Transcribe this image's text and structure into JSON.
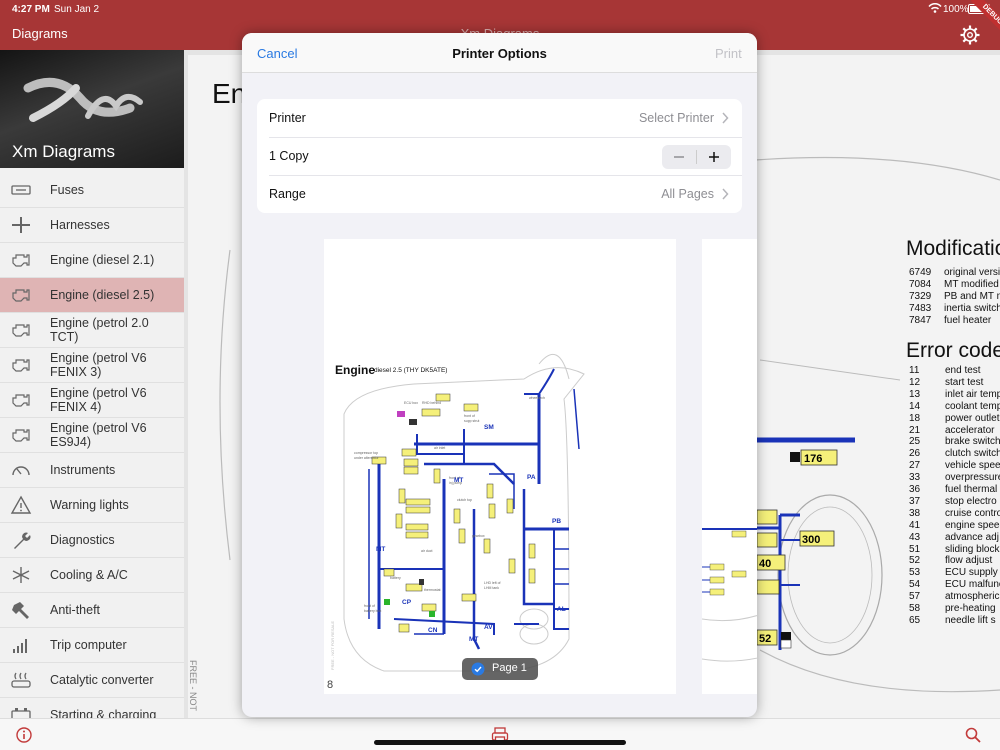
{
  "status": {
    "time": "4:27 PM",
    "date": "Sun Jan 2",
    "battery": "100%"
  },
  "nav": {
    "title": "Diagrams",
    "center_title": "Xm Diagrams",
    "debug_label": "DEBUG"
  },
  "sidebar": {
    "heading": "Xm Diagrams",
    "items": [
      {
        "label": "Fuses",
        "icon": "fuse-icon"
      },
      {
        "label": "Harnesses",
        "icon": "harness-icon"
      },
      {
        "label": "Engine (diesel 2.1)",
        "icon": "engine-icon"
      },
      {
        "label": "Engine (diesel 2.5)",
        "icon": "engine-icon",
        "selected": true
      },
      {
        "label": "Engine (petrol 2.0 TCT)",
        "icon": "engine-icon"
      },
      {
        "label": "Engine (petrol V6 FENIX 3)",
        "icon": "engine-icon"
      },
      {
        "label": "Engine (petrol V6 FENIX 4)",
        "icon": "engine-icon"
      },
      {
        "label": "Engine (petrol V6 ES9J4)",
        "icon": "engine-icon"
      },
      {
        "label": "Instruments",
        "icon": "gauge-icon"
      },
      {
        "label": "Warning lights",
        "icon": "warning-icon"
      },
      {
        "label": "Diagnostics",
        "icon": "wrench-icon"
      },
      {
        "label": "Cooling & A/C",
        "icon": "snowflake-icon"
      },
      {
        "label": "Anti-theft",
        "icon": "hammer-icon"
      },
      {
        "label": "Trip computer",
        "icon": "signal-icon"
      },
      {
        "label": "Catalytic converter",
        "icon": "catalytic-icon"
      },
      {
        "label": "Starting & charging",
        "icon": "battery-icon"
      }
    ]
  },
  "content": {
    "title": "Engine",
    "watermark": "FREE - NOT",
    "modifications_title": "Modifications",
    "modifications": [
      {
        "code": "6749",
        "text": "original version"
      },
      {
        "code": "7084",
        "text": "MT modified"
      },
      {
        "code": "7329",
        "text": "PB and MT modified"
      },
      {
        "code": "7483",
        "text": "inertia switch"
      },
      {
        "code": "7847",
        "text": "fuel heater"
      }
    ],
    "error_title": "Error codes",
    "errors": [
      {
        "code": "11",
        "text": "end test"
      },
      {
        "code": "12",
        "text": "start test"
      },
      {
        "code": "13",
        "text": "inlet air temp"
      },
      {
        "code": "14",
        "text": "coolant temp"
      },
      {
        "code": "18",
        "text": "power outlet"
      },
      {
        "code": "21",
        "text": "accelerator"
      },
      {
        "code": "25",
        "text": "brake switch"
      },
      {
        "code": "26",
        "text": "clutch switch"
      },
      {
        "code": "27",
        "text": "vehicle speed"
      },
      {
        "code": "33",
        "text": "overpressure"
      },
      {
        "code": "36",
        "text": "fuel thermal"
      },
      {
        "code": "37",
        "text": "stop electro"
      },
      {
        "code": "38",
        "text": "cruise control"
      },
      {
        "code": "41",
        "text": "engine speed"
      },
      {
        "code": "43",
        "text": "advance adj"
      },
      {
        "code": "51",
        "text": "sliding block"
      },
      {
        "code": "52",
        "text": "flow adjust"
      },
      {
        "code": "53",
        "text": "ECU supply"
      },
      {
        "code": "54",
        "text": "ECU malfunc"
      },
      {
        "code": "57",
        "text": "atmospheric"
      },
      {
        "code": "58",
        "text": "pre-heating"
      },
      {
        "code": "65",
        "text": "needle lift s"
      }
    ],
    "tags": [
      "176",
      "300",
      "40",
      "52"
    ]
  },
  "modal": {
    "cancel": "Cancel",
    "title": "Printer Options",
    "print": "Print",
    "printer_label": "Printer",
    "printer_value": "Select Printer",
    "copies_label": "1 Copy",
    "range_label": "Range",
    "range_value": "All Pages",
    "page_badge": "Page 1",
    "page_number": "8",
    "preview": {
      "title": "Engine",
      "subtitle": "diesel 2.5 (THY DK5ATE)",
      "labels": [
        "SM",
        "MT",
        "PA",
        "PB",
        "MT",
        "CP",
        "AV",
        "AL",
        "CN",
        "MT"
      ]
    }
  },
  "colors": {
    "brand": "#a73636",
    "accent": "#2a7ae2",
    "wire": "#1a33b8",
    "tag": "#f5f07a"
  }
}
